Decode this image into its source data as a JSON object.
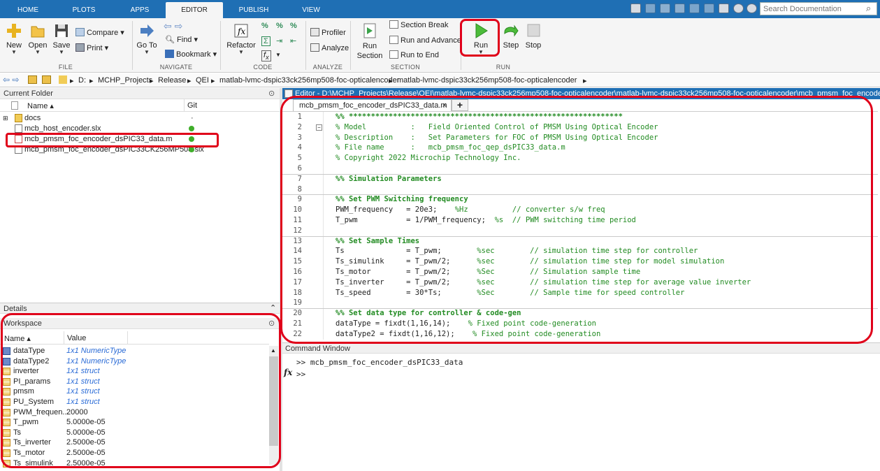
{
  "tabs": [
    "HOME",
    "PLOTS",
    "APPS",
    "EDITOR",
    "PUBLISH",
    "VIEW"
  ],
  "search": {
    "placeholder": "Search Documentation"
  },
  "ribbon": {
    "file": {
      "new": "New",
      "open": "Open",
      "save": "Save",
      "compare": "Compare",
      "print": "Print",
      "group": "FILE"
    },
    "navigate": {
      "goto": "Go To",
      "find": "Find",
      "bookmark": "Bookmark",
      "group": "NAVIGATE"
    },
    "code": {
      "refactor": "Refactor",
      "group": "CODE"
    },
    "analyze": {
      "profiler": "Profiler",
      "analyze": "Analyze",
      "group": "ANALYZE"
    },
    "section": {
      "run_section": "Run Section",
      "section_break": "Section Break",
      "run_advance": "Run and Advance",
      "run_end": "Run to End",
      "group": "SECTION"
    },
    "run": {
      "run": "Run",
      "step": "Step",
      "stop": "Stop",
      "group": "RUN"
    }
  },
  "address": {
    "parts": [
      "D:",
      "MCHP_Projects",
      "Release",
      "QEI",
      "matlab-lvmc-dspic33ck256mp508-foc-opticalencoder",
      "matlab-lvmc-dspic33ck256mp508-foc-opticalencoder"
    ]
  },
  "current_folder": {
    "title": "Current Folder",
    "col_name": "Name ▴",
    "col_git": "Git",
    "items": [
      {
        "name": "docs",
        "git": "·"
      },
      {
        "name": "mcb_host_encoder.slx",
        "git": ""
      },
      {
        "name": "mcb_pmsm_foc_encoder_dsPIC33_data.m",
        "git": ""
      },
      {
        "name": "mcb_pmsm_foc_encoder_dsPIC33CK256MP508.slx",
        "git": ""
      }
    ]
  },
  "details": {
    "title": "Details"
  },
  "workspace": {
    "title": "Workspace",
    "col_name": "Name ▴",
    "col_value": "Value",
    "rows": [
      {
        "name": "dataType",
        "value": "1x1 NumericType",
        "styled": true,
        "icon": "obj"
      },
      {
        "name": "dataType2",
        "value": "1x1 NumericType",
        "styled": true,
        "icon": "obj"
      },
      {
        "name": "inverter",
        "value": "1x1 struct",
        "styled": true,
        "icon": "grid"
      },
      {
        "name": "PI_params",
        "value": "1x1 struct",
        "styled": true,
        "icon": "grid"
      },
      {
        "name": "pmsm",
        "value": "1x1 struct",
        "styled": true,
        "icon": "grid"
      },
      {
        "name": "PU_System",
        "value": "1x1 struct",
        "styled": true,
        "icon": "grid"
      },
      {
        "name": "PWM_frequen...",
        "value": "20000",
        "styled": false,
        "icon": "grid"
      },
      {
        "name": "T_pwm",
        "value": "5.0000e-05",
        "styled": false,
        "icon": "grid"
      },
      {
        "name": "Ts",
        "value": "5.0000e-05",
        "styled": false,
        "icon": "grid"
      },
      {
        "name": "Ts_inverter",
        "value": "2.5000e-05",
        "styled": false,
        "icon": "grid"
      },
      {
        "name": "Ts_motor",
        "value": "2.5000e-05",
        "styled": false,
        "icon": "grid"
      },
      {
        "name": "Ts_simulink",
        "value": "2.5000e-05",
        "styled": false,
        "icon": "grid"
      }
    ]
  },
  "editor": {
    "title": "Editor - D:\\MCHP_Projects\\Release\\QEI\\matlab-lvmc-dspic33ck256mp508-foc-opticalencoder\\matlab-lvmc-dspic33ck256mp508-foc-opticalencoder\\mcb_pmsm_foc_encoder_dsPIC",
    "tab": "mcb_pmsm_foc_encoder_dsPIC33_data.m",
    "lines": [
      {
        "n": "1",
        "code": "",
        "cm": "%% **************************************************************",
        "bold": true,
        "sec": false
      },
      {
        "n": "2",
        "code": "",
        "cm": "% Model          :   Field Oriented Control of PMSM Using Optical Encoder",
        "bold": false,
        "sec": false
      },
      {
        "n": "3",
        "code": "",
        "cm": "% Description    :   Set Parameters for FOC of PMSM Using Optical Encoder",
        "bold": false,
        "sec": false
      },
      {
        "n": "4",
        "code": "",
        "cm": "% File name      :   mcb_pmsm_foc_qep_dsPIC33_data.m",
        "bold": false,
        "sec": false
      },
      {
        "n": "5",
        "code": "",
        "cm": "% Copyright 2022 Microchip Technology Inc.",
        "bold": false,
        "sec": false
      },
      {
        "n": "6",
        "code": "",
        "cm": "",
        "bold": false,
        "sec": false
      },
      {
        "n": "7",
        "code": "",
        "cm": "%% Simulation Parameters",
        "bold": true,
        "sec": true
      },
      {
        "n": "8",
        "code": "",
        "cm": "",
        "bold": false,
        "sec": false
      },
      {
        "n": "9",
        "code": "",
        "cm": "%% Set PWM Switching frequency",
        "bold": true,
        "sec": true
      },
      {
        "n": "10",
        "code": "PWM_frequency   = 20e3;    ",
        "cm": "%Hz          // converter s/w freq",
        "bold": false,
        "sec": false
      },
      {
        "n": "11",
        "code": "T_pwm           = 1/PWM_frequency;  ",
        "cm": "%s  // PWM switching time period",
        "bold": false,
        "sec": false
      },
      {
        "n": "12",
        "code": "",
        "cm": "",
        "bold": false,
        "sec": false
      },
      {
        "n": "13",
        "code": "",
        "cm": "%% Set Sample Times",
        "bold": true,
        "sec": true
      },
      {
        "n": "14",
        "code": "Ts              = T_pwm;        ",
        "cm": "%sec        // simulation time step for controller",
        "bold": false,
        "sec": false
      },
      {
        "n": "15",
        "code": "Ts_simulink     = T_pwm/2;      ",
        "cm": "%sec        // simulation time step for model simulation",
        "bold": false,
        "sec": false
      },
      {
        "n": "16",
        "code": "Ts_motor        = T_pwm/2;      ",
        "cm": "%Sec        // Simulation sample time",
        "bold": false,
        "sec": false
      },
      {
        "n": "17",
        "code": "Ts_inverter     = T_pwm/2;      ",
        "cm": "%sec        // simulation time step for average value inverter",
        "bold": false,
        "sec": false
      },
      {
        "n": "18",
        "code": "Ts_speed        = 30*Ts;        ",
        "cm": "%Sec        // Sample time for speed controller",
        "bold": false,
        "sec": false
      },
      {
        "n": "19",
        "code": "",
        "cm": "",
        "bold": false,
        "sec": false
      },
      {
        "n": "20",
        "code": "",
        "cm": "%% Set data type for controller & code-gen",
        "bold": true,
        "sec": true
      },
      {
        "n": "21",
        "code": "dataType = fixdt(1,16,14);    ",
        "cm": "% Fixed point code-generation",
        "bold": false,
        "sec": false
      },
      {
        "n": "22",
        "code": "dataType2 = fixdt(1,16,12);    ",
        "cm": "% Fixed point code-generation",
        "bold": false,
        "sec": false
      }
    ]
  },
  "command": {
    "title": "Command Window",
    "line1": ">> mcb_pmsm_foc_encoder_dsPIC33_data",
    "line2": ">>",
    "fx": "fx"
  },
  "colors": {
    "accent": "#1f6fb4",
    "annotation": "#e0001a",
    "git_ok": "#3fae2a",
    "comment": "#228b22"
  }
}
